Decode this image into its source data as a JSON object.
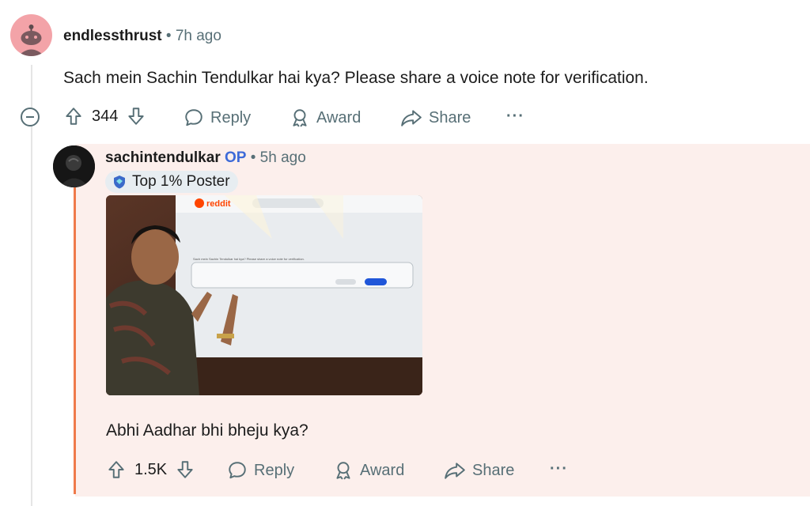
{
  "comment": {
    "username": "endlessthrust",
    "separator": "•",
    "time": "7h ago",
    "text": "Sach mein Sachin Tendulkar hai kya? Please share a voice note for verification.",
    "votes": "344",
    "reply_label": "Reply",
    "award_label": "Award",
    "share_label": "Share",
    "more_label": "···"
  },
  "reply": {
    "username": "sachintendulkar",
    "op_badge": "OP",
    "separator": "•",
    "time": "5h ago",
    "flair": "Top 1% Poster",
    "text": "Abhi Aadhar bhi bheju kya?",
    "votes": "1.5K",
    "reply_label": "Reply",
    "award_label": "Award",
    "share_label": "Share",
    "more_label": "···",
    "photo": {
      "screen_logo": "reddit",
      "screen_comment_text": "Sach mein Sachin Tendulkar hai kya? Please share a voice note for verification."
    }
  },
  "colors": {
    "op_highlight_bg": "#fcefec",
    "op_bar": "#ef7a4b",
    "op_text": "#3d6ad8",
    "meta_gray": "#576f76",
    "avatar_pink": "#f3a3a8"
  }
}
